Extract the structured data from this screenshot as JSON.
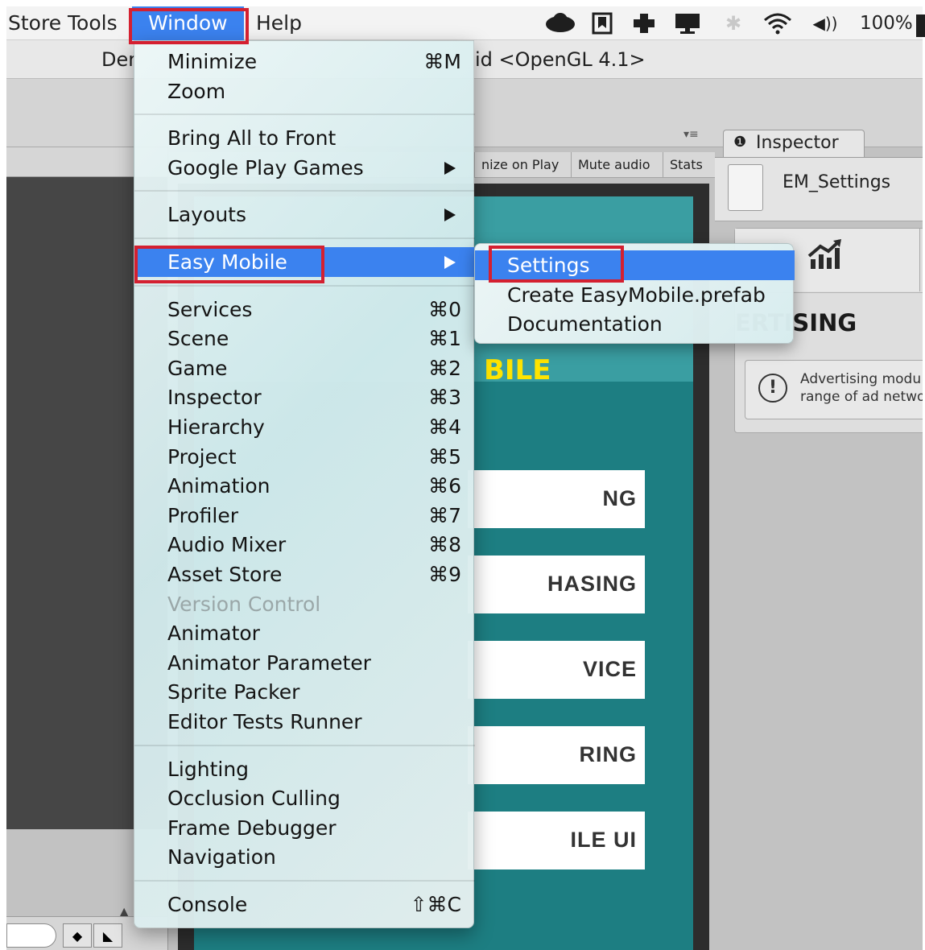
{
  "menubar": {
    "items": [
      "Store Tools",
      "Window",
      "Help"
    ],
    "status_battery": "100%"
  },
  "editor": {
    "title_left": "Der",
    "title_right": "id <OpenGL 4.1>",
    "game_toolbar": [
      "nize on Play",
      "Mute audio",
      "Stats"
    ],
    "game": {
      "title": "BILE",
      "buttons": [
        "NG",
        "HASING",
        "VICE",
        "RING",
        "ILE UI"
      ]
    },
    "inspector": {
      "tab": "Inspector",
      "asset_name": "EM_Settings",
      "section_title": "ERTISING",
      "note_line1": "Advertising modu",
      "note_line2": "range of ad netwo"
    }
  },
  "window_menu": {
    "groups": [
      [
        {
          "label": "Minimize",
          "shortcut": "⌘M"
        },
        {
          "label": "Zoom",
          "shortcut": ""
        }
      ],
      [
        {
          "label": "Bring All to Front",
          "shortcut": ""
        },
        {
          "label": "Google Play Games",
          "shortcut": "",
          "submenu": true
        }
      ],
      [
        {
          "label": "Layouts",
          "shortcut": "",
          "submenu": true
        }
      ],
      [
        {
          "label": "Easy Mobile",
          "shortcut": "",
          "submenu": true,
          "selected": true
        }
      ],
      [
        {
          "label": "Services",
          "shortcut": "⌘0"
        },
        {
          "label": "Scene",
          "shortcut": "⌘1"
        },
        {
          "label": "Game",
          "shortcut": "⌘2"
        },
        {
          "label": "Inspector",
          "shortcut": "⌘3"
        },
        {
          "label": "Hierarchy",
          "shortcut": "⌘4"
        },
        {
          "label": "Project",
          "shortcut": "⌘5"
        },
        {
          "label": "Animation",
          "shortcut": "⌘6"
        },
        {
          "label": "Profiler",
          "shortcut": "⌘7"
        },
        {
          "label": "Audio Mixer",
          "shortcut": "⌘8"
        },
        {
          "label": "Asset Store",
          "shortcut": "⌘9"
        },
        {
          "label": "Version Control",
          "shortcut": "",
          "disabled": true
        },
        {
          "label": "Animator",
          "shortcut": ""
        },
        {
          "label": "Animator Parameter",
          "shortcut": ""
        },
        {
          "label": "Sprite Packer",
          "shortcut": ""
        },
        {
          "label": "Editor Tests Runner",
          "shortcut": ""
        }
      ],
      [
        {
          "label": "Lighting",
          "shortcut": ""
        },
        {
          "label": "Occlusion Culling",
          "shortcut": ""
        },
        {
          "label": "Frame Debugger",
          "shortcut": ""
        },
        {
          "label": "Navigation",
          "shortcut": ""
        }
      ],
      [
        {
          "label": "Console",
          "shortcut": "⇧⌘C"
        }
      ]
    ]
  },
  "easy_mobile_submenu": [
    {
      "label": "Settings",
      "selected": true
    },
    {
      "label": "Create EasyMobile.prefab"
    },
    {
      "label": "Documentation"
    }
  ],
  "colors": {
    "menu_highlight": "#3b82ef",
    "annotation_red": "#d42030",
    "game_teal": "#1d7e82",
    "game_title_yellow": "#ffe400"
  }
}
